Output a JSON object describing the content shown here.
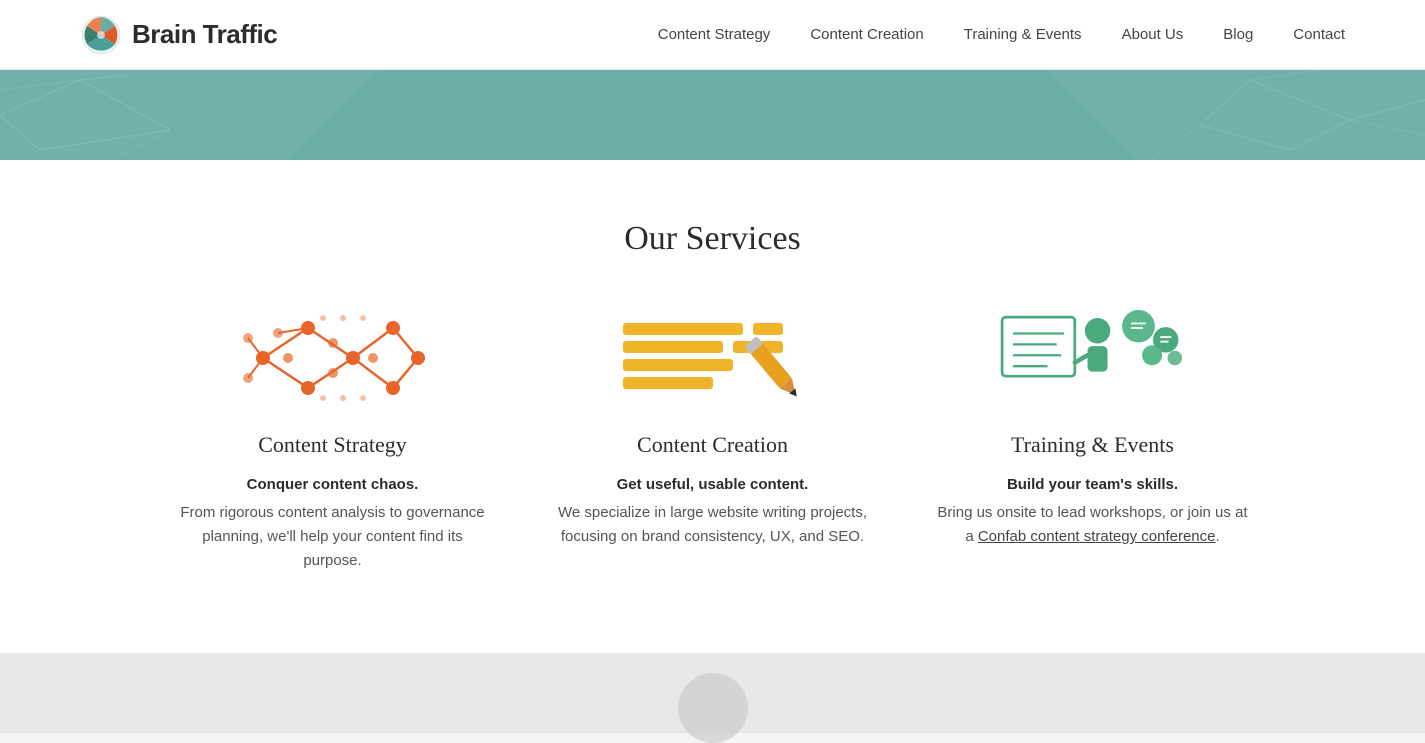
{
  "logo": {
    "text": "Brain Traffic",
    "icon_label": "brain-traffic-logo-icon"
  },
  "nav": {
    "items": [
      {
        "label": "Content Strategy",
        "href": "#"
      },
      {
        "label": "Content Creation",
        "href": "#"
      },
      {
        "label": "Training & Events",
        "href": "#"
      },
      {
        "label": "About Us",
        "href": "#"
      },
      {
        "label": "Blog",
        "href": "#"
      },
      {
        "label": "Contact",
        "href": "#"
      }
    ]
  },
  "services": {
    "section_title": "Our Services",
    "cards": [
      {
        "name": "Content Strategy",
        "tagline": "Conquer content chaos.",
        "description": "From rigorous content analysis to governance planning, we'll help your content find its purpose.",
        "link_text": null,
        "link_href": null
      },
      {
        "name": "Content Creation",
        "tagline": "Get useful, usable content.",
        "description": "We specialize in large website writing projects, focusing on brand consistency, UX, and SEO.",
        "link_text": null,
        "link_href": null
      },
      {
        "name": "Training & Events",
        "tagline": "Build your team's skills.",
        "description": "Bring us onsite to lead workshops, or join us at a ",
        "link_text": "Confab content strategy conference",
        "link_href": "#"
      }
    ]
  },
  "colors": {
    "teal": "#6aada6",
    "orange": "#e8652a",
    "yellow": "#f0b429",
    "green": "#4aaa7e",
    "dark_green": "#3d7f6e",
    "icon_teal": "#5aaa9e"
  }
}
